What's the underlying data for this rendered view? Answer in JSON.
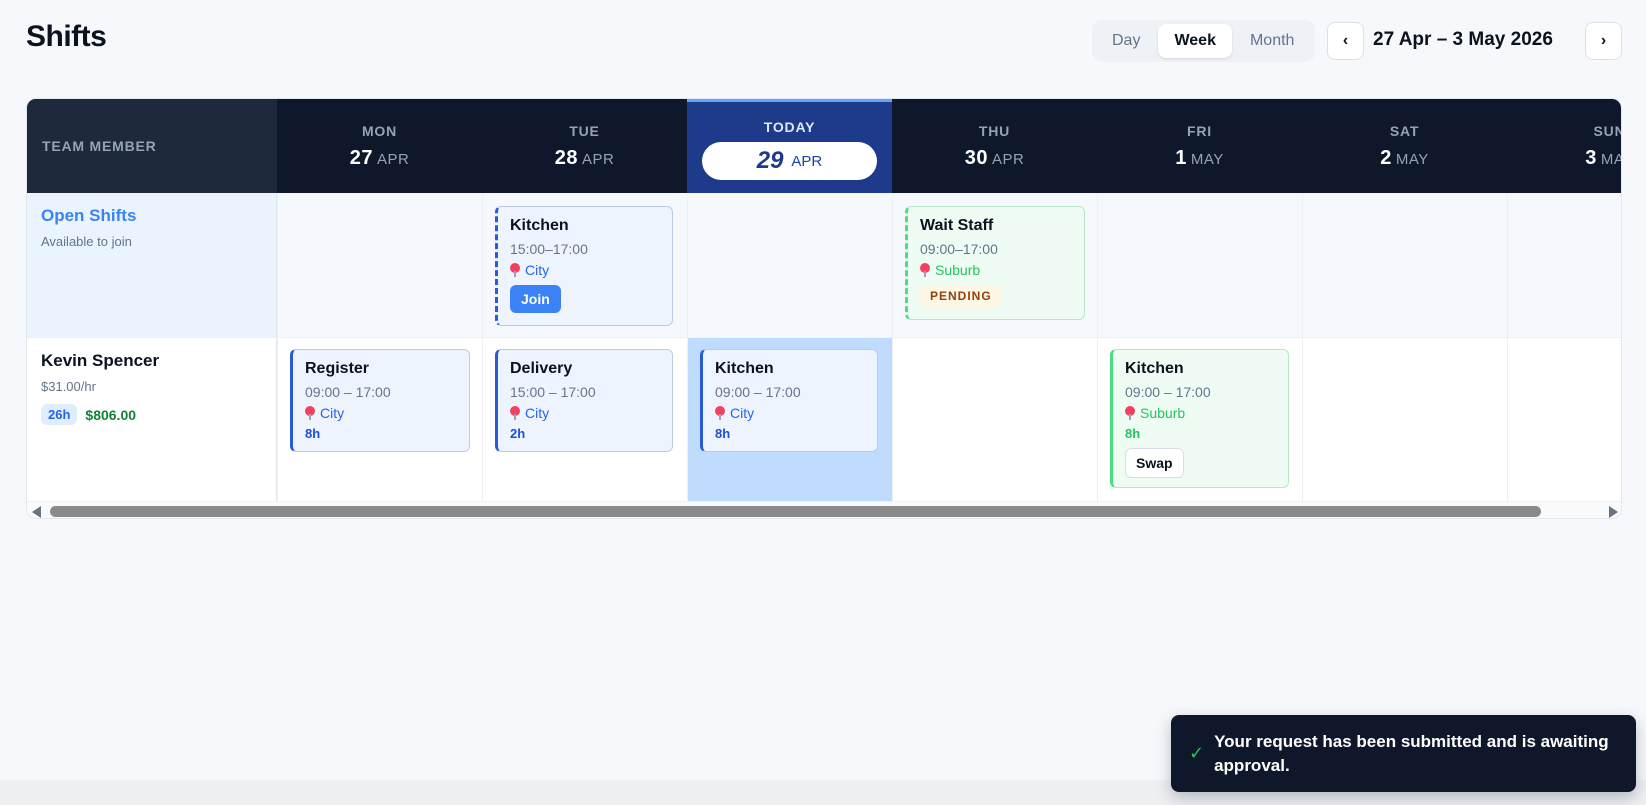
{
  "page": {
    "title": "Shifts"
  },
  "views": {
    "day": "Day",
    "week": "Week",
    "month": "Month",
    "selected": "Week"
  },
  "nav": {
    "prev": "‹",
    "next": "›",
    "range": "27 Apr – 3 May 2026"
  },
  "grid": {
    "member_header": "TEAM MEMBER",
    "days": [
      {
        "dow": "MON",
        "num": "27",
        "mon": "APR"
      },
      {
        "dow": "TUE",
        "num": "28",
        "mon": "APR"
      },
      {
        "dow": "TODAY",
        "num": "29",
        "mon": "APR"
      },
      {
        "dow": "THU",
        "num": "30",
        "mon": "APR"
      },
      {
        "dow": "FRI",
        "num": "1",
        "mon": "MAY"
      },
      {
        "dow": "SAT",
        "num": "2",
        "mon": "MAY"
      },
      {
        "dow": "SUN",
        "num": "3",
        "mon": "MAY"
      }
    ]
  },
  "open_shifts": {
    "title": "Open Shifts",
    "subtitle": "Available to join",
    "tue": {
      "role": "Kitchen",
      "time": "15:00–17:00",
      "location": "City",
      "action": "Join"
    },
    "thu": {
      "role": "Wait Staff",
      "time": "09:00–17:00",
      "location": "Suburb",
      "status": "PENDING"
    }
  },
  "employee": {
    "name": "Kevin Spencer",
    "rate": "$31.00/hr",
    "hours": "26h",
    "pay": "$806.00",
    "shifts": {
      "mon": {
        "role": "Register",
        "time": "09:00 – 17:00",
        "location": "City",
        "duration": "8h"
      },
      "tue": {
        "role": "Delivery",
        "time": "15:00 – 17:00",
        "location": "City",
        "duration": "2h"
      },
      "wed": {
        "role": "Kitchen",
        "time": "09:00 – 17:00",
        "location": "City",
        "duration": "8h"
      },
      "fri": {
        "role": "Kitchen",
        "time": "09:00 – 17:00",
        "location": "Suburb",
        "duration": "8h",
        "action": "Swap"
      }
    }
  },
  "toast": {
    "icon": "check-icon",
    "message": "Your request has been submitted and is awaiting approval."
  },
  "colors": {
    "header_bg": "#0f172a",
    "today_bg": "#1e3a8a",
    "accent_blue": "#3b82f6",
    "accent_green": "#22c55e"
  }
}
